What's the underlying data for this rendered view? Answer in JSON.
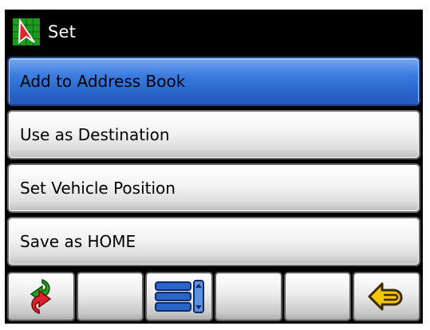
{
  "window": {
    "title": "Set",
    "icon": "navigation-arrow-icon"
  },
  "menu": {
    "items": [
      {
        "label": "Add to Address Book",
        "selected": true
      },
      {
        "label": "Use as Destination",
        "selected": false
      },
      {
        "label": "Set Vehicle Position",
        "selected": false
      },
      {
        "label": "Save as HOME",
        "selected": false
      }
    ]
  },
  "toolbar": {
    "buttons": [
      {
        "icon": "reroute-arrows-icon"
      },
      {
        "icon": ""
      },
      {
        "icon": "list-menu-icon"
      },
      {
        "icon": ""
      },
      {
        "icon": ""
      },
      {
        "icon": "back-arrow-icon"
      }
    ]
  },
  "colors": {
    "selected": "#2a64c9",
    "background": "#000000",
    "back_arrow": "#f2c500"
  }
}
